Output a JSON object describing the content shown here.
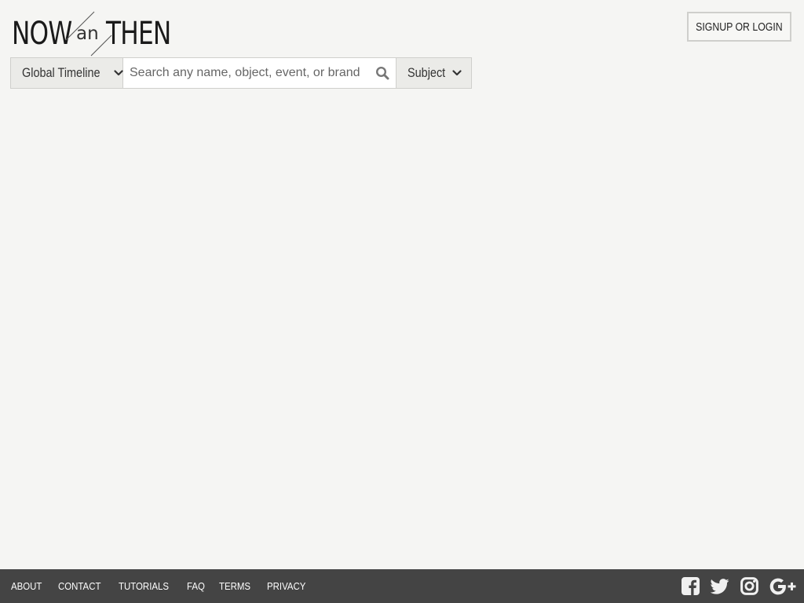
{
  "logo": {
    "now": "NOW",
    "an": "an",
    "then": "THEN"
  },
  "header": {
    "signup_label": "SIGNUP OR LOGIN"
  },
  "search": {
    "timeline_label": "Global Timeline",
    "placeholder": "Search any name, object, event, or brand",
    "value": "",
    "subject_label": "Subject"
  },
  "footer": {
    "links": [
      "ABOUT",
      "CONTACT",
      "TUTORIALS",
      "FAQ",
      "TERMS",
      "PRIVACY"
    ],
    "social_icons": [
      "facebook-icon",
      "twitter-icon",
      "instagram-icon",
      "google-plus-icon"
    ]
  },
  "colors": {
    "page_background": "#f5f5f3",
    "footer_background": "#444444",
    "dropdown_background": "#ebebe8",
    "border": "#cfcfcc"
  }
}
